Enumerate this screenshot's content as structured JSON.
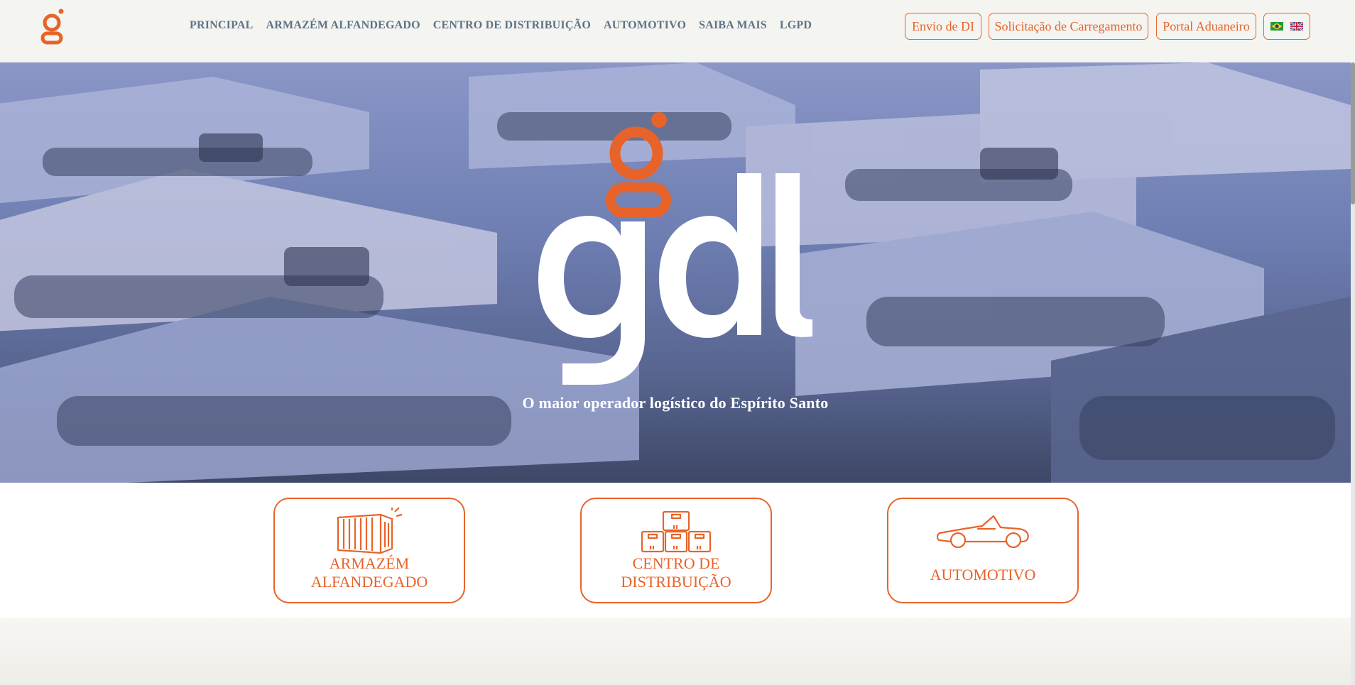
{
  "header": {
    "nav": [
      "PRINCIPAL",
      "ARMAZÉM ALFANDEGADO",
      "CENTRO DE DISTRIBUIÇÃO",
      "AUTOMOTIVO",
      "SAIBA MAIS",
      "LGPD"
    ],
    "buttons": {
      "envio_di": "Envio de DI",
      "carregamento": "Solicitação de Carregamento",
      "portal": "Portal Aduaneiro"
    },
    "languages": [
      "pt-BR flag",
      "en-GB flag"
    ]
  },
  "hero": {
    "logo_text": "gdl",
    "tagline": "O maior operador logístico do Espírito Santo"
  },
  "cards": [
    {
      "icon": "container-icon",
      "label_line1": "ARMAZÉM",
      "label_line2": "ALFANDEGADO"
    },
    {
      "icon": "boxes-icon",
      "label_line1": "CENTRO DE",
      "label_line2": "DISTRIBUIÇÃO"
    },
    {
      "icon": "car-icon",
      "label": "AUTOMOTIVO"
    }
  ],
  "colors": {
    "accent": "#e8632a",
    "nav": "#5d7388",
    "hero_tint": "#6f7fb3"
  }
}
